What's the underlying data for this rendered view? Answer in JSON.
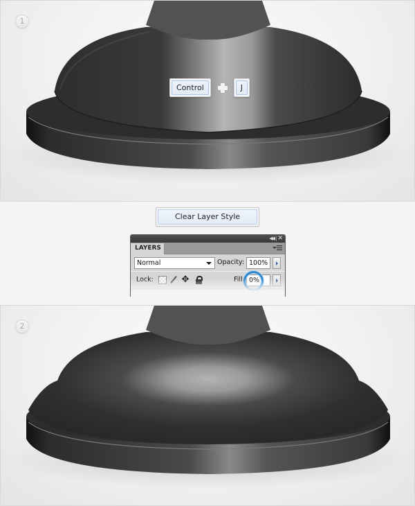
{
  "steps": [
    {
      "number": "1",
      "shortcut": {
        "keys": [
          "Control",
          "J"
        ],
        "separator_icon": "plus-icon"
      }
    },
    {
      "number": "2"
    }
  ],
  "clear_layer_style_button": {
    "label": "Clear Layer Style"
  },
  "layers_panel": {
    "tab_label": "LAYERS",
    "titlebar_icons": [
      "collapse-icon",
      "close-icon"
    ],
    "menu_icon": "panel-menu-icon",
    "blend_mode": {
      "selected": "Normal"
    },
    "opacity": {
      "label": "Opacity:",
      "value": "100%"
    },
    "lock": {
      "label": "Lock:",
      "icons": [
        "lock-transparent-pixels-icon",
        "lock-image-pixels-icon",
        "lock-position-icon",
        "lock-all-icon"
      ]
    },
    "fill": {
      "label": "Fill:",
      "value": "0%"
    }
  },
  "colors": {
    "highlight_ring": "#2f88cf",
    "key_border": "#a9c6ea",
    "object_dark": "#2a2a2a",
    "object_stem": "#555354"
  }
}
